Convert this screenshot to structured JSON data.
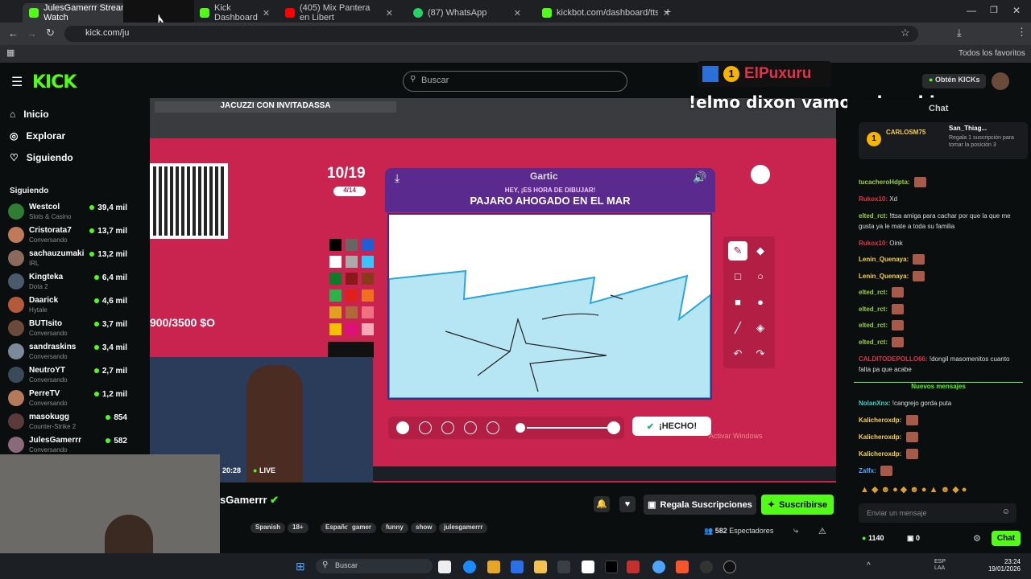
{
  "tabs": [
    {
      "label": "JulesGamerrr Stream - Watch",
      "active": true
    },
    {
      "label": "Kick Dashboard"
    },
    {
      "label": "(405) Mix Pantera en Libert"
    },
    {
      "label": "(87) WhatsApp"
    },
    {
      "label": "kickbot.com/dashboard/tts/set"
    }
  ],
  "address": "kick.com/ju",
  "bookmarks_right": "Todos los favoritos",
  "header": {
    "search_placeholder": "Buscar",
    "obtain_kicks": "Obtén KICKs"
  },
  "nav": [
    {
      "label": "Inicio"
    },
    {
      "label": "Explorar"
    },
    {
      "label": "Siguiendo"
    }
  ],
  "following_title": "Siguiendo",
  "channels": [
    {
      "name": "Westcol",
      "category": "Slots & Casino",
      "viewers": "39,4 mil"
    },
    {
      "name": "Cristorata7",
      "category": "Conversando",
      "viewers": "13,7 mil"
    },
    {
      "name": "sachauzumaki",
      "category": "IRL",
      "viewers": "13,2 mil"
    },
    {
      "name": "Kingteka",
      "category": "Dota 2",
      "viewers": "6,4 mil"
    },
    {
      "name": "Daarick",
      "category": "Hytale",
      "viewers": "4,6 mil"
    },
    {
      "name": "BUTIsito",
      "category": "Conversando",
      "viewers": "3,7 mil"
    },
    {
      "name": "sandraskins",
      "category": "Conversando",
      "viewers": "3,4 mil"
    },
    {
      "name": "NeutroYT",
      "category": "Conversando",
      "viewers": "2,7 mil"
    },
    {
      "name": "PerreTV",
      "category": "Conversando",
      "viewers": "1,2 mil"
    },
    {
      "name": "masokugg",
      "category": "Counter-Strike 2",
      "viewers": "854"
    },
    {
      "name": "JulesGamerrr",
      "category": "Conversando",
      "viewers": "582"
    }
  ],
  "stream": {
    "banner": "JACUZZI CON INVITADASSA",
    "score": "10/19",
    "sub_score": "4/14",
    "money": "900/3500 $O",
    "game_title": "Gartic",
    "prompt_small": "HEY, ¡ES HORA DE DIBUJAR!",
    "prompt": "PAJARO AHOGADO EN EL MAR",
    "done_button": "¡HECHO!",
    "time": "20:28",
    "live": "LIVE",
    "overlay_user": "ElPuxuru",
    "overlay_level": "1",
    "overlay_msg": "!elmo dixon vamos al sachi",
    "windows_watermark": "Activar Windows"
  },
  "streamer": {
    "name": "JulesGamerrr",
    "name_visible": "sGamerrr",
    "tags": [
      "Spanish",
      "18+",
      "Español",
      "gamer",
      "funny",
      "show",
      "julesgamerrr"
    ],
    "gift_button": "Regala Suscripciones",
    "subscribe_button": "Suscribirse",
    "viewers": "582",
    "viewers_label": "Espectadores"
  },
  "chat": {
    "title": "Chat",
    "pinned_user": "CARLOSM75",
    "gift_user": "San_Thiag...",
    "gift_text": "Regala 1 suscripción para tomar la posición 3",
    "messages": [
      {
        "user": "tucacheroHdpta:",
        "text": "",
        "color": "#9bd23a"
      },
      {
        "user": "Rukox10:",
        "text": "Xd",
        "color": "#e0334b"
      },
      {
        "user": "elted_rct:",
        "text": "!ttsa amiga para cachar por que la que me gusta ya le mate a toda su familia",
        "color": "#9bd23a"
      },
      {
        "user": "Rukox10:",
        "text": "Oink",
        "color": "#e0334b"
      },
      {
        "user": "Lenin_Quenaya:",
        "text": "",
        "color": "#f5d04a"
      },
      {
        "user": "Lenin_Quenaya:",
        "text": "",
        "color": "#f5d04a"
      },
      {
        "user": "elted_rct:",
        "text": "",
        "color": "#9bd23a"
      },
      {
        "user": "elted_rct:",
        "text": "",
        "color": "#9bd23a"
      },
      {
        "user": "elted_rct:",
        "text": "",
        "color": "#9bd23a"
      },
      {
        "user": "elted_rct:",
        "text": "",
        "color": "#9bd23a"
      },
      {
        "user": "CALDITODEPOLLO66:",
        "text": "!dongil masomenitos cuanto falta pa que acabe",
        "color": "#e0334b"
      }
    ],
    "new_messages": "Nuevos mensajes",
    "new": [
      {
        "user": "NolanXnx:",
        "text": "!cangrejo gorda puta",
        "color": "#3ad2c6"
      },
      {
        "user": "Kalicheroxdp:",
        "text": "",
        "color": "#f5d04a"
      },
      {
        "user": "Kalicheroxdp:",
        "text": "",
        "color": "#f5d04a"
      },
      {
        "user": "Kalicheroxdp:",
        "text": "",
        "color": "#f5d04a"
      },
      {
        "user": "Zaffx:",
        "text": "",
        "color": "#5aa0ff"
      }
    ],
    "input_placeholder": "Enviar un mensaje",
    "kicks": "1140",
    "gift_count": "0",
    "send_button": "Chat"
  },
  "taskbar": {
    "search": "Buscar",
    "lang": "ESP LAA",
    "time": "23:24",
    "date": "19/01/2026"
  },
  "colors": {
    "kick_green": "#53fc18",
    "stream_bg": "#c8244f",
    "gartic_purple": "#5a2a8e"
  }
}
